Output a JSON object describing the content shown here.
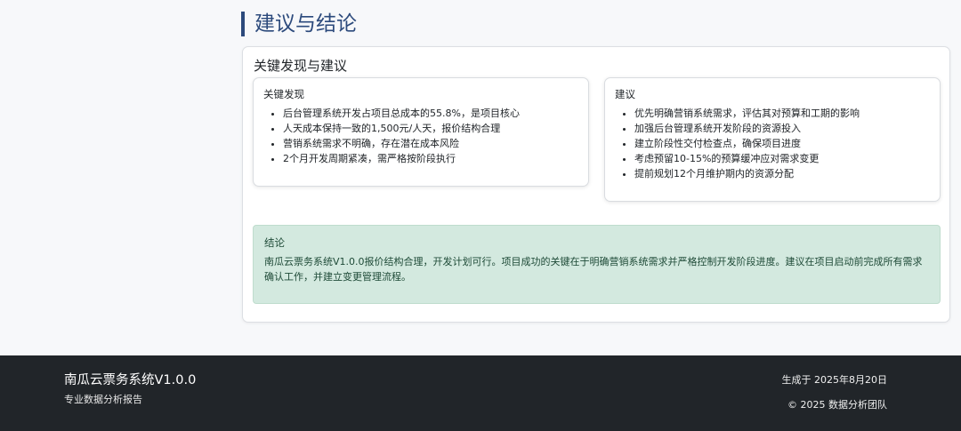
{
  "section_title": "建议与结论",
  "card": {
    "heading": "关键发现与建议",
    "findings": {
      "title": "关键发现",
      "items": [
        "后台管理系统开发占项目总成本的55.8%，是项目核心",
        "人天成本保持一致的1,500元/人天，报价结构合理",
        "营销系统需求不明确，存在潜在成本风险",
        "2个月开发周期紧凑，需严格按阶段执行"
      ]
    },
    "recommendations": {
      "title": "建议",
      "items": [
        "优先明确营销系统需求，评估其对预算和工期的影响",
        "加强后台管理系统开发阶段的资源投入",
        "建立阶段性交付检查点，确保项目进度",
        "考虑预留10-15%的预算缓冲应对需求变更",
        "提前规划12个月维护期内的资源分配"
      ]
    },
    "conclusion": {
      "title": "结论",
      "text": "南瓜云票务系统V1.0.0报价结构合理，开发计划可行。项目成功的关键在于明确营销系统需求并严格控制开发阶段进度。建议在项目启动前完成所有需求确认工作，并建立变更管理流程。",
      "background_color": "#d3e9df"
    }
  },
  "footer": {
    "brand": "南瓜云票务系统V1.0.0",
    "subtitle": "专业数据分析报告",
    "generated": "生成于 2025年8月20日",
    "copyright": "© 2025 数据分析团队",
    "background_color": "#212529"
  },
  "colors": {
    "accent": "#2c4a7c",
    "page_background": "#f7f8fa"
  }
}
